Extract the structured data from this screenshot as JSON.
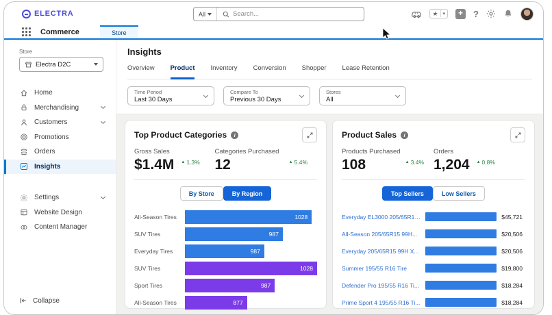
{
  "theme": {
    "accent_blue": "#0176d3",
    "toggle_active_blue": "#1565d8",
    "bar_blue": "#2f7ce2",
    "bar_purple": "#7c3be8",
    "positive_green": "#2e844a",
    "link_blue": "#2e6fd0",
    "logo_indigo": "#4c4ce0"
  },
  "header": {
    "logo_text": "ELECTRA",
    "search": {
      "scope": "All",
      "placeholder": "Search..."
    }
  },
  "app_nav": {
    "app_name": "Commerce",
    "active_tab": "Store"
  },
  "sidebar": {
    "store_label": "Store",
    "store_value": "Electra D2C",
    "items": [
      {
        "label": "Home"
      },
      {
        "label": "Merchandising"
      },
      {
        "label": "Customers"
      },
      {
        "label": "Promotions"
      },
      {
        "label": "Orders"
      },
      {
        "label": "Insights"
      }
    ],
    "secondary_items": [
      {
        "label": "Settings"
      },
      {
        "label": "Website Design"
      },
      {
        "label": "Content Manager"
      }
    ],
    "collapse_label": "Collapse"
  },
  "insights": {
    "title": "Insights",
    "tabs": [
      "Overview",
      "Product",
      "Inventory",
      "Conversion",
      "Shopper",
      "Lease Retention"
    ],
    "active_tab": "Product",
    "filters": [
      {
        "label": "Time Period",
        "value": "Last 30 Days"
      },
      {
        "label": "Compare To",
        "value": "Previous 30 Days"
      },
      {
        "label": "Stores",
        "value": "All"
      }
    ]
  },
  "cards": [
    {
      "title": "Top Product Categories",
      "metrics": [
        {
          "label": "Gross Sales",
          "value": "$1.4M",
          "delta": "1.3%",
          "direction": "up"
        },
        {
          "label": "Categories Purchased",
          "value": "12",
          "delta": "5.4%",
          "direction": "up"
        }
      ],
      "toggle": {
        "options": [
          "By Store",
          "By Region"
        ],
        "active": "By Region"
      },
      "chart": {
        "type": "bar",
        "rows": [
          {
            "label": "All-Season Tires",
            "value": "1028",
            "width_pct": 96,
            "bar_color": "#2f7ce2"
          },
          {
            "label": "SUV Tires",
            "value": "987",
            "width_pct": 74,
            "bar_color": "#2f7ce2"
          },
          {
            "label": "Everyday Tires",
            "value": "987",
            "width_pct": 60,
            "bar_color": "#2f7ce2"
          },
          {
            "label": "SUV Tires",
            "value": "1028",
            "width_pct": 100,
            "bar_color": "#7c3be8"
          },
          {
            "label": "Sport Tires",
            "value": "987",
            "width_pct": 68,
            "bar_color": "#7c3be8"
          },
          {
            "label": "All-Season Tires",
            "value": "877",
            "width_pct": 47,
            "bar_color": "#7c3be8"
          }
        ]
      }
    },
    {
      "title": "Product Sales",
      "metrics": [
        {
          "label": "Products Purchased",
          "value": "108",
          "delta": "3.4%",
          "direction": "up"
        },
        {
          "label": "Orders",
          "value": "1,204",
          "delta": "0.8%",
          "direction": "up"
        }
      ],
      "toggle": {
        "options": [
          "Top Sellers",
          "Low Sellers"
        ],
        "active": "Top Sellers"
      },
      "chart": {
        "type": "bar",
        "rows": [
          {
            "label": "Everyday EL3000 205/65R15...",
            "value": "$45,721",
            "width_pct": 100,
            "bar_color": "#2f7ce2"
          },
          {
            "label": "All-Season 205/65R15 99H...",
            "value": "$20,506",
            "width_pct": 82,
            "bar_color": "#2f7ce2"
          },
          {
            "label": "Everyday 205/65R15 99H X...",
            "value": "$20,506",
            "width_pct": 82,
            "bar_color": "#2f7ce2"
          },
          {
            "label": "Summer 195/55 R16 Tire",
            "value": "$19,800",
            "width_pct": 80,
            "bar_color": "#2f7ce2"
          },
          {
            "label": "Defender Pro 195/55 R16 Ti...",
            "value": "$18,284",
            "width_pct": 75,
            "bar_color": "#2f7ce2"
          },
          {
            "label": "Prime Sport 4 195/55 R16 Ti...",
            "value": "$18,284",
            "width_pct": 75,
            "bar_color": "#2f7ce2"
          }
        ]
      }
    }
  ]
}
